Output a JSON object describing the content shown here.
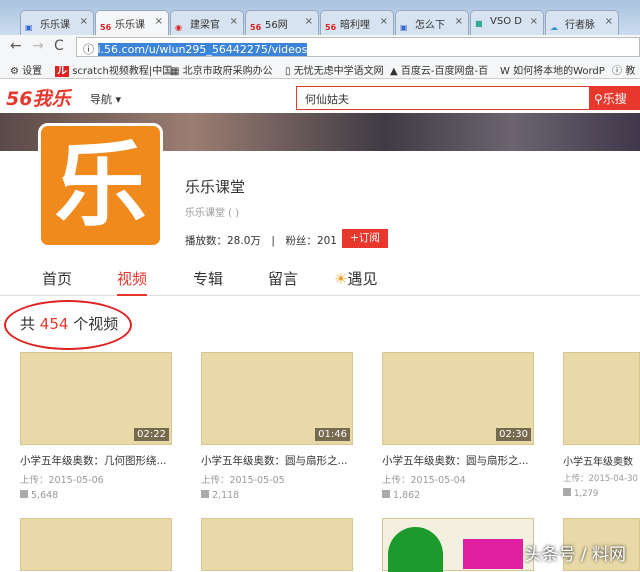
{
  "browser": {
    "tabs": [
      "乐乐课",
      "乐乐课",
      "建梁官",
      "56网",
      "暗利哩",
      "怎么下",
      "VSO D",
      "行者脉"
    ],
    "url": "i.56.com/u/wlun295_56442275/videos",
    "bookmarks": [
      "设置",
      "scratch视频教程|中国",
      "北京市政府采购办公",
      "无忧无虑中学语文网",
      "百度云-百度网盘-百",
      "如何将本地的WordP",
      "教"
    ]
  },
  "site": {
    "logo": "56我乐",
    "nav": "导航",
    "search_value": "何仙姑夫",
    "search_button": "乐搜"
  },
  "channel": {
    "avatar_char": "乐",
    "name": "乐乐课堂",
    "sub": "乐乐课堂 ( )",
    "plays_label": "播放数：",
    "plays": "28.0万",
    "fans_label": "粉丝：",
    "fans": "201",
    "subscribe": "+订阅"
  },
  "tabs": [
    "首页",
    "视频",
    "专辑",
    "留言",
    "遇见"
  ],
  "count": {
    "prefix": "共",
    "number": "454",
    "suffix": "个视频"
  },
  "videos": [
    {
      "title": "小学五年级奥数：几何图形绕...",
      "date": "上传：2015-05-06",
      "views": "5,648",
      "duration": "02:22"
    },
    {
      "title": "小学五年级奥数：圆与扇形之...",
      "date": "上传：2015-05-05",
      "views": "2,118",
      "duration": "01:46"
    },
    {
      "title": "小学五年级奥数：圆与扇形之...",
      "date": "上传：2015-05-04",
      "views": "1,862",
      "duration": "02:30"
    },
    {
      "title": "小学五年级奥数",
      "date": "上传：2015-04-30",
      "views": "1,279",
      "duration": ""
    }
  ],
  "watermark": "头条号 / 料网"
}
